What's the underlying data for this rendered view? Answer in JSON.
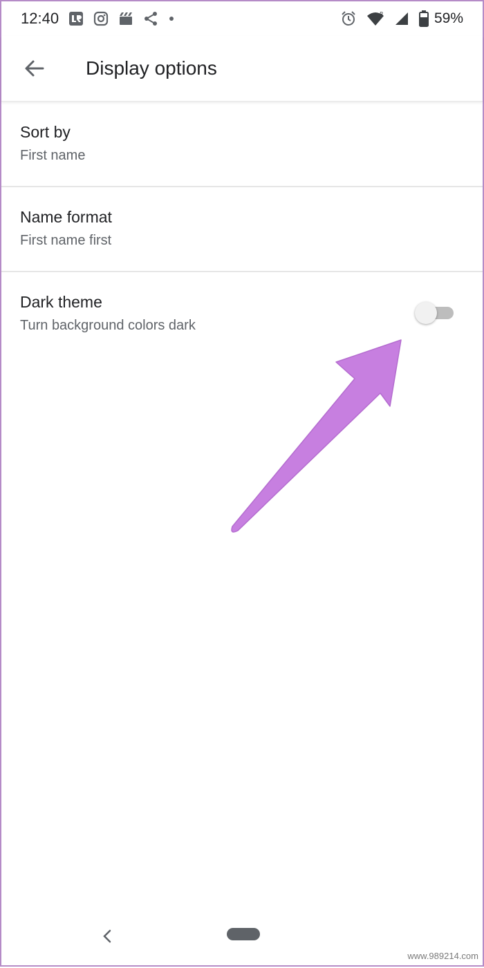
{
  "status_bar": {
    "time": "12:40",
    "left_icons": [
      "lr-app-icon",
      "instagram-icon",
      "clapper-icon",
      "share-icon",
      "dot-icon"
    ],
    "right_icons": [
      "alarm-icon",
      "wifi-icon",
      "signal-icon",
      "battery-icon"
    ],
    "battery_percent": "59%"
  },
  "app_bar": {
    "back_icon": "arrow-left-icon",
    "title": "Display options"
  },
  "settings": [
    {
      "title": "Sort by",
      "subtitle": "First name"
    },
    {
      "title": "Name format",
      "subtitle": "First name first"
    },
    {
      "title": "Dark theme",
      "subtitle": "Turn background colors dark",
      "toggle_on": false
    }
  ],
  "annotation": {
    "color": "#c77fe0"
  },
  "nav_bar": {
    "back_icon": "chevron-left-icon",
    "home_icon": "home-pill-icon"
  },
  "watermark": "www.989214.com",
  "colors": {
    "frame_border": "#b58bc7",
    "text_primary": "#202124",
    "text_secondary": "#5f6368"
  }
}
